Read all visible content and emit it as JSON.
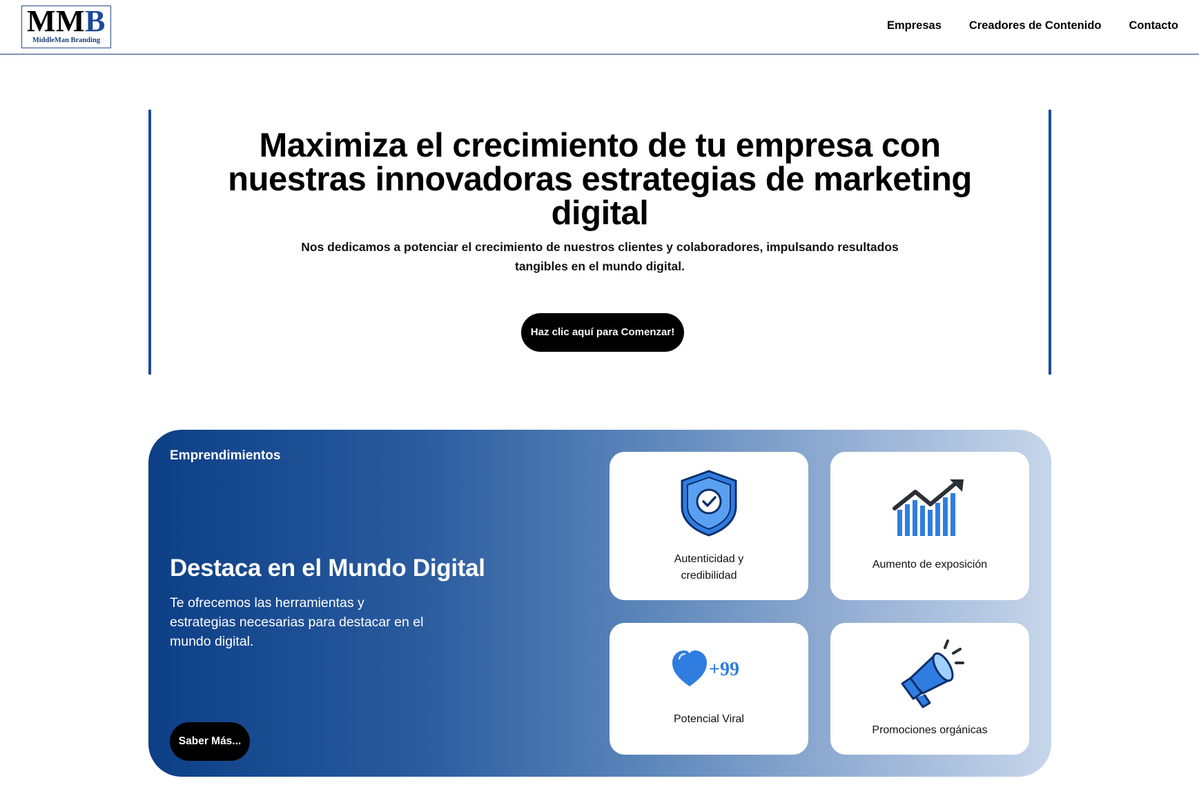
{
  "header": {
    "logo": {
      "mark_part1": "MM",
      "mark_part2": "B",
      "subtitle": "MiddleMan Branding"
    },
    "nav": [
      "Empresas",
      "Creadores de Contenido",
      "Contacto"
    ]
  },
  "hero": {
    "title": "Maximiza el crecimiento de tu empresa con nuestras innovadoras estrategias de marketing digital",
    "subtitle": "Nos dedicamos a potenciar el crecimiento de nuestros clientes y colaboradores, impulsando resultados tangibles en el mundo digital.",
    "cta_label": "Haz clic aquí para Comenzar!"
  },
  "feature": {
    "tag": "Emprendimientos",
    "title": "Destaca en el Mundo Digital",
    "description": "Te ofrecemos las herramientas y estrategias necesarias para destacar en el mundo digital.",
    "button_label": "Saber Más...",
    "cards": [
      {
        "icon": "shield-check-icon",
        "label": "Autenticidad y credibilidad"
      },
      {
        "icon": "growth-chart-icon",
        "label": "Aumento de exposición"
      },
      {
        "icon": "heart-icon",
        "badge": "+99",
        "label": "Potencial Viral"
      },
      {
        "icon": "megaphone-icon",
        "label": "Promociones orgánicas"
      }
    ]
  },
  "colors": {
    "brand_blue": "#1d4a9a",
    "icon_blue": "#2f7de1",
    "gradient_start": "#0d3f87",
    "gradient_end": "#c6d6ea",
    "button_black": "#000000"
  }
}
